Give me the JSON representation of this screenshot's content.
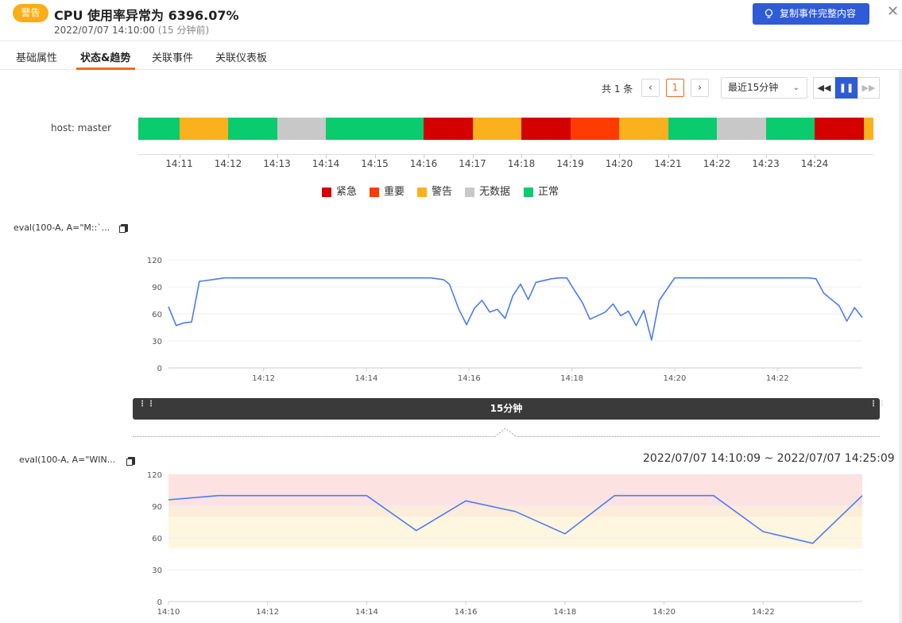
{
  "header": {
    "badge": "警告",
    "title": "CPU 使用率异常为 6396.07%",
    "time": "2022/07/07 14:10:00",
    "relative": "(15 分钟前)",
    "copy_button": "复制事件完整内容",
    "close": "✕"
  },
  "tabs": [
    {
      "label": "基础属性"
    },
    {
      "label": "状态&趋势"
    },
    {
      "label": "关联事件"
    },
    {
      "label": "关联仪表板"
    }
  ],
  "pagination": {
    "total": "共 1 条",
    "prev": "‹",
    "current": "1",
    "next": "›"
  },
  "time_range": {
    "selected": "最近15分钟",
    "arrow": "⌄"
  },
  "playback": {
    "rewind": "◀◀",
    "pause": "❚❚",
    "forward": "▶▶"
  },
  "status": {
    "host_label": "host: master",
    "ticks": [
      "14:11",
      "14:12",
      "14:13",
      "14:14",
      "14:15",
      "14:16",
      "14:17",
      "14:18",
      "14:19",
      "14:20",
      "14:21",
      "14:22",
      "14:23",
      "14:24"
    ],
    "segments": [
      "正常",
      "警告",
      "正常",
      "无数据",
      "正常",
      "正常",
      "紧急",
      "警告",
      "紧急",
      "重要",
      "警告",
      "正常",
      "无数据",
      "正常",
      "紧急",
      "警告"
    ],
    "legend": [
      {
        "label": "紧急",
        "color": "#d40000"
      },
      {
        "label": "重要",
        "color": "#ff3b00"
      },
      {
        "label": "警告",
        "color": "#fbb11e"
      },
      {
        "label": "无数据",
        "color": "#c8c8c8"
      },
      {
        "label": "正常",
        "color": "#0acb6e"
      }
    ]
  },
  "metric1": {
    "label": "eval(100-A, A=\"M::`..."
  },
  "metric2": {
    "label": "eval(100-A, A=\"WIN..."
  },
  "brush": {
    "label": "15分钟",
    "left_grip": "⋮⋮",
    "right_grip": "⋮⋮"
  },
  "range_text": "2022/07/07 14:10:09 ~ 2022/07/07 14:25:09",
  "chart_data": [
    {
      "type": "line",
      "x_ticks": [
        "14:12",
        "14:14",
        "14:16",
        "14:18",
        "14:20",
        "14:22"
      ],
      "ylim": [
        0,
        120
      ],
      "y_ticks": [
        "0",
        "30",
        "60",
        "90",
        "120"
      ],
      "line_color": "#4a7cf3",
      "grid": true,
      "series": [
        {
          "x": [
            "14:10:09",
            "14:10:18",
            "14:10:27",
            "14:10:36",
            "14:10:45",
            "14:11:00",
            "14:11:15",
            "14:11:30",
            "14:12:00",
            "14:13:00",
            "14:14:00",
            "14:15:00",
            "14:15:15",
            "14:15:30",
            "14:15:37",
            "14:15:48",
            "14:15:57",
            "14:16:06",
            "14:16:15",
            "14:16:24",
            "14:16:33",
            "14:16:42",
            "14:16:51",
            "14:17:00",
            "14:17:09",
            "14:17:18",
            "14:17:36",
            "14:17:45",
            "14:17:54",
            "14:18:03",
            "14:18:12",
            "14:18:21",
            "14:18:39",
            "14:18:48",
            "14:18:57",
            "14:19:06",
            "14:19:15",
            "14:19:24",
            "14:19:33",
            "14:19:42",
            "14:20:00",
            "14:21:00",
            "14:22:00",
            "14:22:36",
            "14:22:45",
            "14:22:54",
            "14:23:12",
            "14:23:21",
            "14:23:30",
            "14:23:39"
          ],
          "values": [
            68,
            47,
            50,
            51,
            96,
            98,
            100,
            100,
            100,
            100,
            100,
            100,
            100,
            98,
            93,
            65,
            48,
            66,
            75,
            62,
            65,
            55,
            80,
            93,
            76,
            95,
            99,
            100,
            100,
            86,
            73,
            54,
            62,
            71,
            58,
            63,
            47,
            64,
            31,
            75,
            100,
            100,
            100,
            100,
            99,
            83,
            69,
            52,
            67,
            56
          ]
        }
      ]
    },
    {
      "type": "line",
      "x_ticks": [
        "14:10",
        "14:12",
        "14:14",
        "14:16",
        "14:18",
        "14:20",
        "14:22"
      ],
      "ylim": [
        0,
        120
      ],
      "y_ticks": [
        "0",
        "30",
        "60",
        "90",
        "120"
      ],
      "line_color": "#4a7cf3",
      "grid": true,
      "bands": [
        {
          "from": 90,
          "to": 120,
          "color": "#fde2e2"
        },
        {
          "from": 80,
          "to": 90,
          "color": "#fdecd9"
        },
        {
          "from": 50,
          "to": 80,
          "color": "#fef6df"
        }
      ],
      "series": [
        {
          "x": [
            "14:10",
            "14:11",
            "14:12",
            "14:13",
            "14:14",
            "14:15",
            "14:16",
            "14:17",
            "14:18",
            "14:19",
            "14:20",
            "14:21",
            "14:22",
            "14:23",
            "14:24"
          ],
          "values": [
            96,
            100,
            100,
            100,
            100,
            67,
            95,
            85,
            64,
            100,
            100,
            100,
            66,
            55,
            100
          ]
        }
      ]
    }
  ]
}
